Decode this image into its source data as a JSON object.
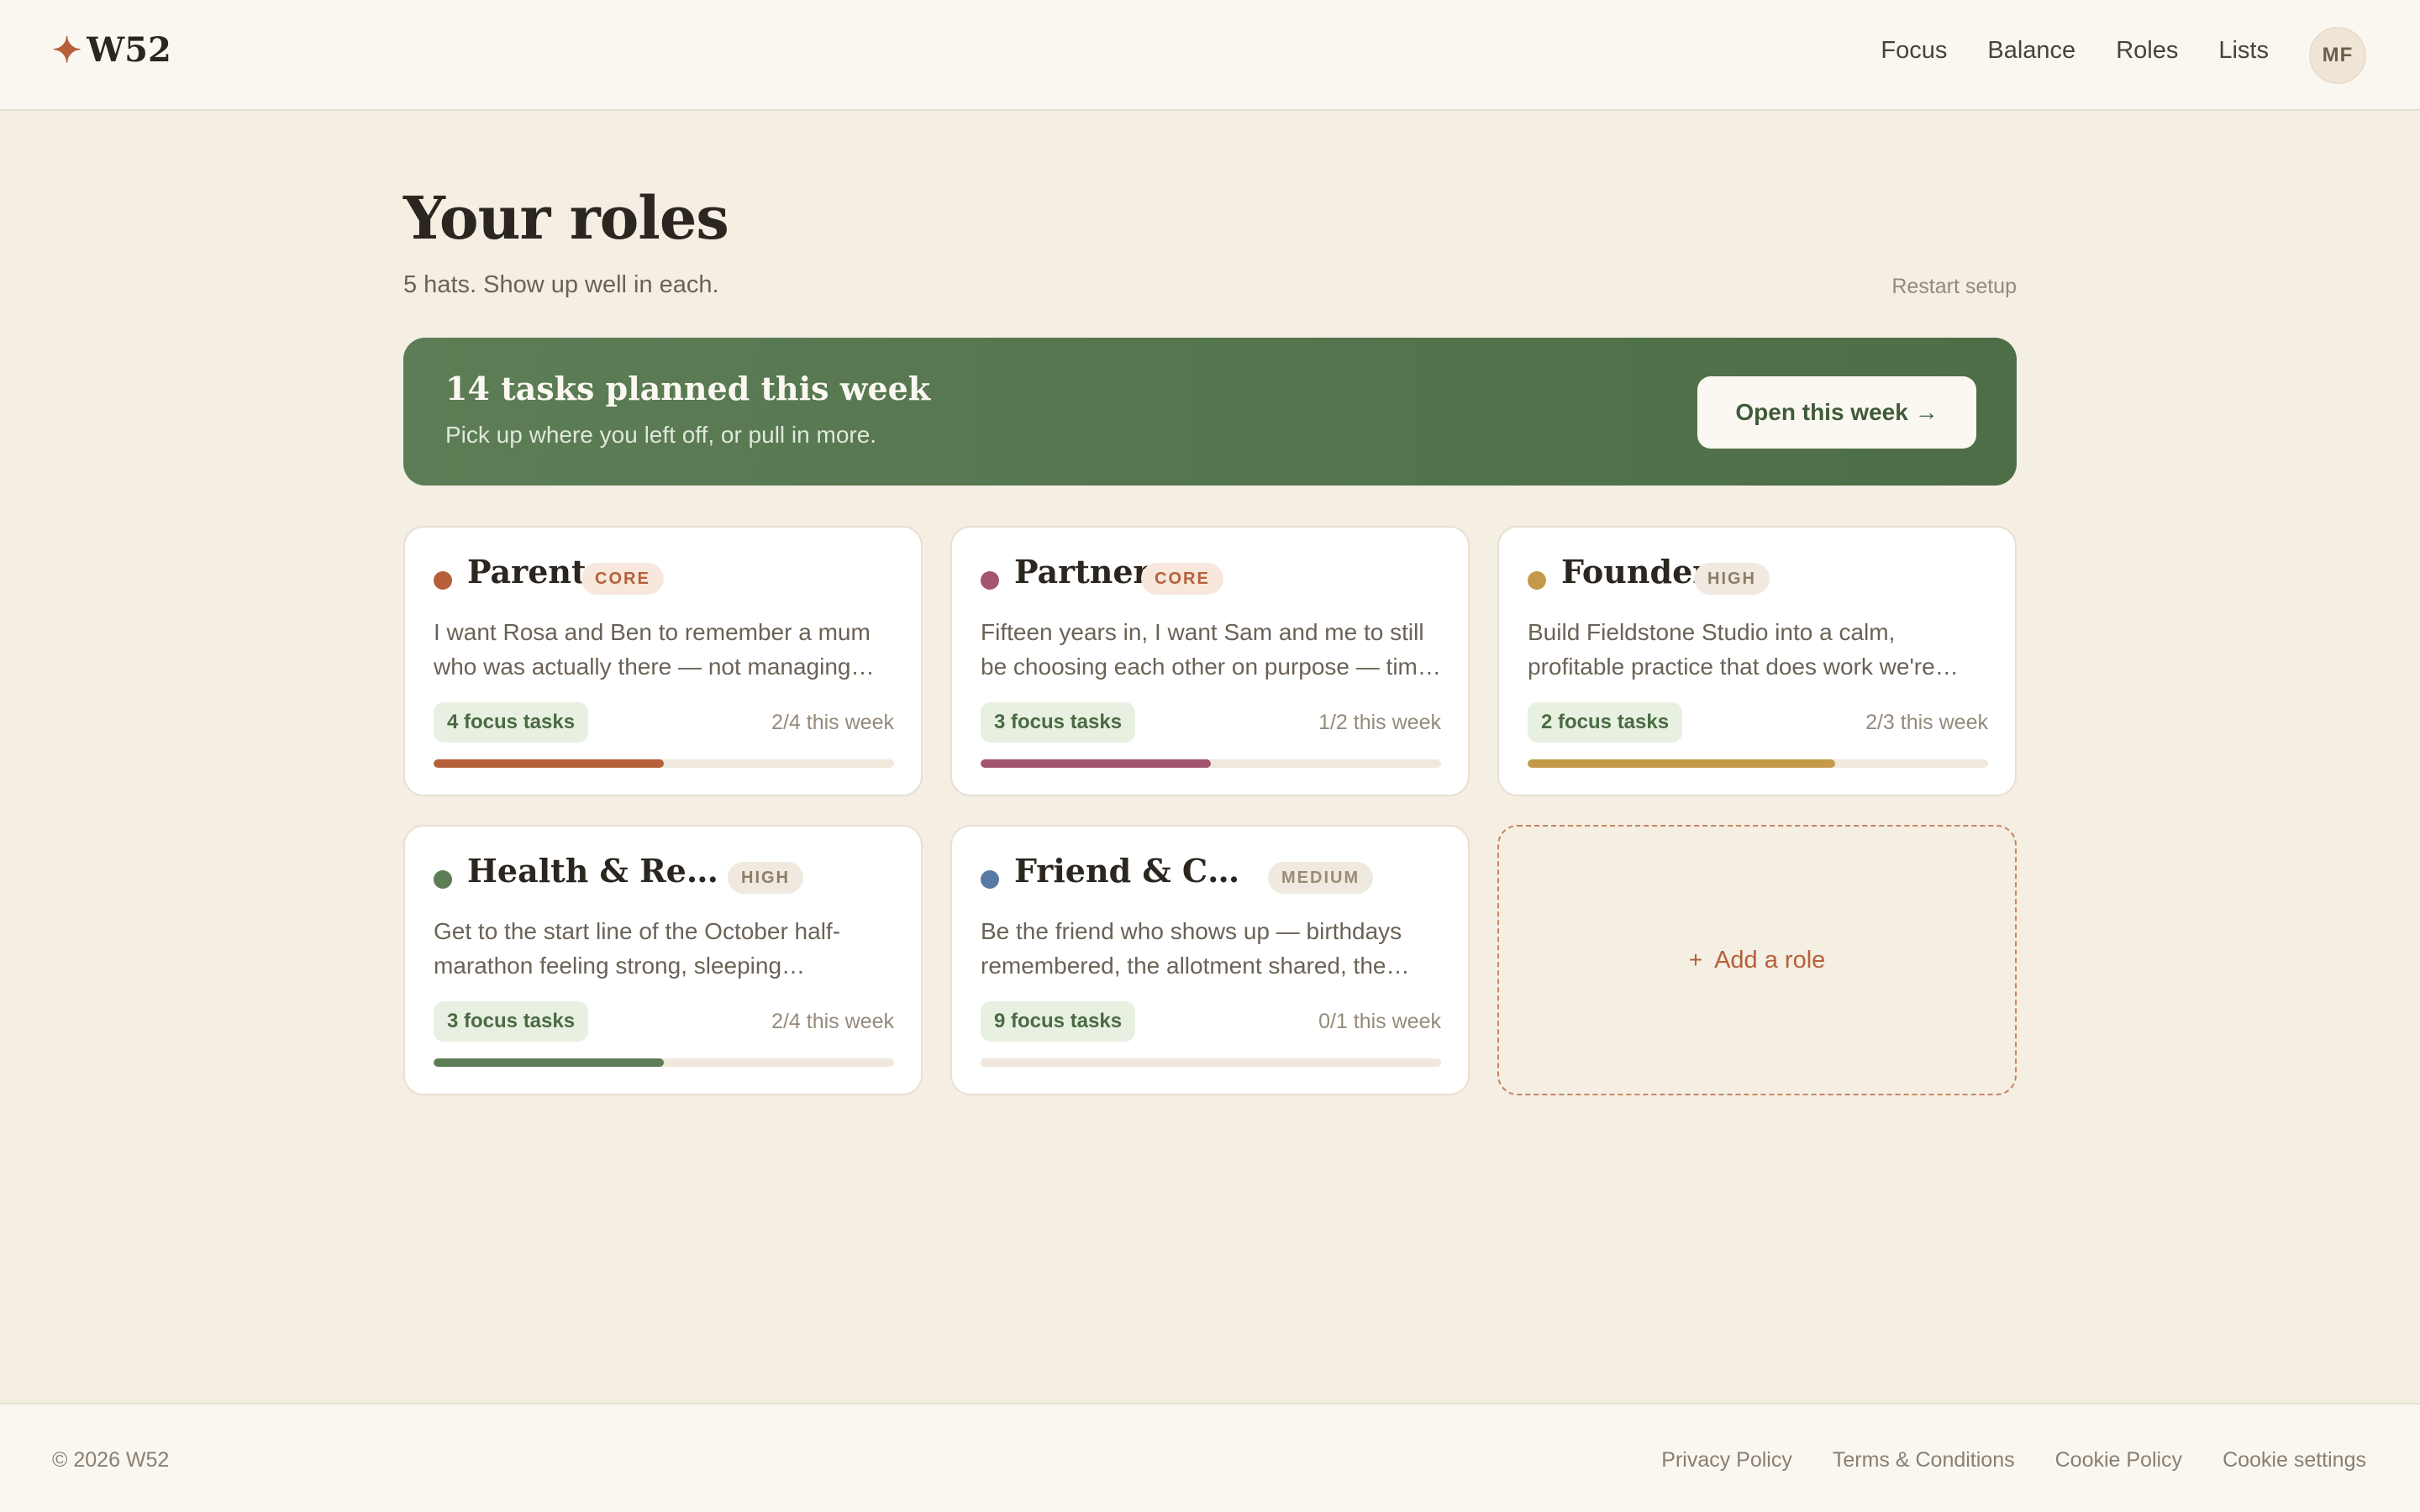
{
  "app": {
    "logo_text": "W52",
    "logo_icon": "sparkle-icon",
    "brand_color": "#b5603a"
  },
  "nav": {
    "items": [
      "Focus",
      "Balance",
      "Roles",
      "Lists"
    ],
    "avatar_initials": "MF"
  },
  "page": {
    "title": "Your roles",
    "subtitle": "5 hats. Show up well in each.",
    "restart_label": "Restart setup"
  },
  "banner": {
    "title": "14 tasks planned this week",
    "subtitle": "Pick up where you left off, or pull in more.",
    "button_label": "Open this week →",
    "color": "#577850"
  },
  "roles": [
    {
      "name": "Parent",
      "badge": "CORE",
      "badge_type": "core",
      "color": "#b5603a",
      "desc_line1": "I want Rosa and Ben to remember a mum",
      "desc_line2": "who was actually there — not managing…",
      "focus": "4 focus tasks",
      "week": "2/4 this week",
      "progress": 0.5
    },
    {
      "name": "Partner",
      "badge": "CORE",
      "badge_type": "core",
      "color": "#a35470",
      "desc_line1": "Fifteen years in, I want Sam and me to still",
      "desc_line2": "be choosing each other on purpose — tim…",
      "focus": "3 focus tasks",
      "week": "1/2 this week",
      "progress": 0.5
    },
    {
      "name": "Founder",
      "badge": "HIGH",
      "badge_type": "high",
      "color": "#c49a4a",
      "desc_line1": "Build Fieldstone Studio into a calm,",
      "desc_line2": "profitable practice that does work we're…",
      "focus": "2 focus tasks",
      "week": "2/3 this week",
      "progress": 0.667
    },
    {
      "name": "Health & Renewal",
      "badge": "HIGH",
      "badge_type": "high",
      "color": "#5c7d55",
      "desc_line1": "Get to the start line of the October half-",
      "desc_line2": "marathon feeling strong, sleeping…",
      "focus": "3 focus tasks",
      "week": "2/4 this week",
      "progress": 0.5
    },
    {
      "name": "Friend & Com…",
      "badge": "MEDIUM",
      "badge_type": "medium",
      "color": "#5a7aa6",
      "desc_line1": "Be the friend who shows up — birthdays",
      "desc_line2": "remembered, the allotment shared, the…",
      "focus": "9 focus tasks",
      "week": "0/1 this week",
      "progress": 0
    }
  ],
  "add_role_label": "Add a role",
  "footer": {
    "copyright": "© 2026 W52",
    "links": [
      "Privacy Policy",
      "Terms & Conditions",
      "Cookie Policy",
      "Cookie settings"
    ]
  }
}
